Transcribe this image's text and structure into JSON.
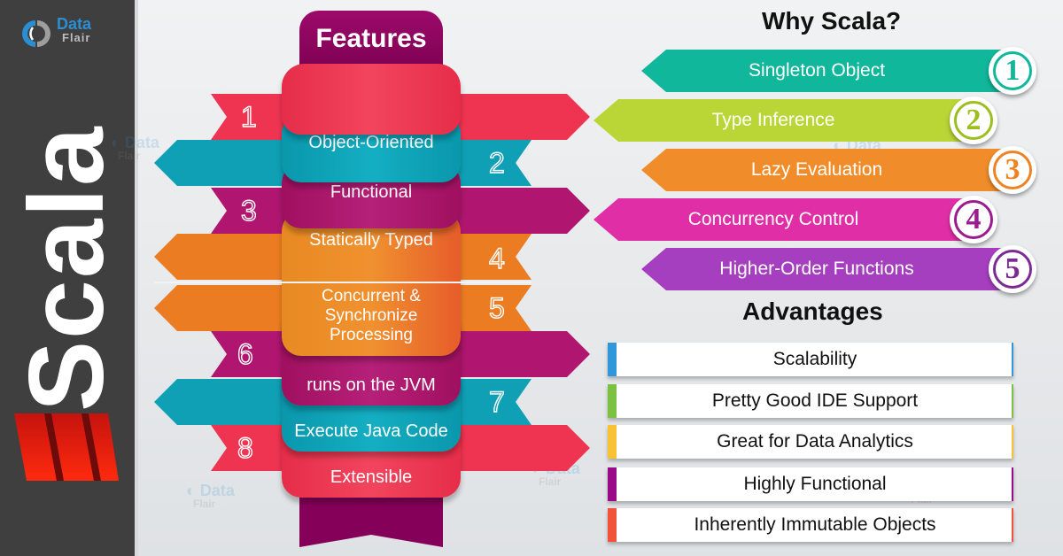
{
  "brand": {
    "name_line1": "Data",
    "name_line2": "Flair"
  },
  "sidebar": {
    "title": "Scala",
    "logo_icon": "scala-logo-icon"
  },
  "features": {
    "heading": "Features",
    "items": [
      {
        "number": "1",
        "label": "Object-Oriented",
        "color": "#0fa0b5"
      },
      {
        "number": "2",
        "label": "Functional",
        "color": "#b0166f"
      },
      {
        "number": "3",
        "label": "Statically Typed",
        "color": "#ec7c22"
      },
      {
        "number": "4",
        "label": "Concurrent & Synchronize Processing",
        "color": "#ec7c22"
      },
      {
        "number": "5",
        "label": "runs on the JVM",
        "color": "#b0166f"
      },
      {
        "number": "6",
        "label": "Execute Java Code",
        "color": "#0fa0b5"
      },
      {
        "number": "7",
        "label": "Extensible",
        "color": "#ee3450"
      },
      {
        "number": "8",
        "label": "",
        "color": "#ee3450"
      }
    ],
    "ribbon_colors": {
      "red": "#ee3450",
      "teal": "#0fa0b5",
      "purple": "#b0166f",
      "orange": "#ec7c22",
      "dark_purple": "#850058"
    }
  },
  "why_scala": {
    "title": "Why Scala?",
    "items": [
      {
        "number": "1",
        "label": "Singleton Object",
        "color": "#10b79a"
      },
      {
        "number": "2",
        "label": "Type Inference",
        "color": "#b9d536"
      },
      {
        "number": "3",
        "label": "Lazy Evaluation",
        "color": "#f08d2a"
      },
      {
        "number": "4",
        "label": "Concurrency Control",
        "color": "#e02fa6"
      },
      {
        "number": "5",
        "label": "Higher-Order Functions",
        "color": "#a63fbf"
      }
    ]
  },
  "advantages": {
    "title": "Advantages",
    "items": [
      {
        "label": "Scalability",
        "color": "#2f97da"
      },
      {
        "label": "Pretty Good IDE Support",
        "color": "#7cc242"
      },
      {
        "label": "Great for Data Analytics",
        "color": "#f7c233"
      },
      {
        "label": "Highly Functional",
        "color": "#9b0a86"
      },
      {
        "label": "Inherently Immutable Objects",
        "color": "#f2523a"
      }
    ]
  }
}
